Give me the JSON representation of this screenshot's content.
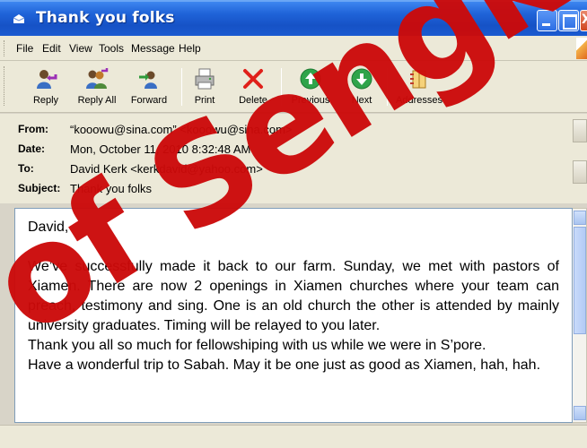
{
  "window": {
    "title": "Thank you folks"
  },
  "menu": [
    "File",
    "Edit",
    "View",
    "Tools",
    "Message",
    "Help"
  ],
  "toolbar": {
    "reply": "Reply",
    "reply_all": "Reply All",
    "forward": "Forward",
    "print": "Print",
    "delete": "Delete",
    "previous": "Previous",
    "next": "Next",
    "addresses": "Addresses"
  },
  "headers": {
    "from_label": "From:",
    "from": "“kooowu@sina.com” <kooowu@sina.com>",
    "date_label": "Date:",
    "date": "Mon, October 11, 2010 8:32:48 AM",
    "to_label": "To:",
    "to": "David Kerk <kerkdavid@yahoo.com>",
    "subject_label": "Subject:",
    "subject": "Thank you folks"
  },
  "body": {
    "greeting": "David,",
    "para1": "We’ve successfully made it back to our farm. Sunday, we met with pastors of Xiamen. There are now 2 openings in Xiamen churches where your team can preach, testimony and sing. One is an old church the other is attended by mainly university graduates. Timing will be relayed to you later.",
    "para2": "Thank you all so much for fellowshiping with us while we were in S’pore.",
    "para3": "Have a wonderful trip to Sabah. May it be one just as good as Xiamen, hah, hah."
  },
  "watermark": {
    "text": "of Sengkang"
  },
  "colors": {
    "titlebar": "#1f63d8",
    "chrome": "#ece9d8",
    "watermark": "#cc0a0a"
  }
}
